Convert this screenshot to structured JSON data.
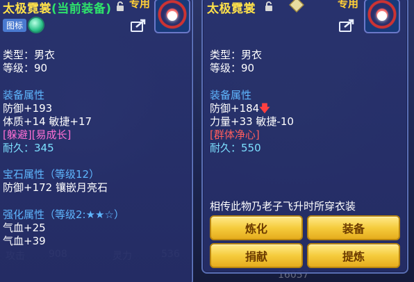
{
  "background": {
    "stat_attack_label": "攻击",
    "stat_attack_value": "908",
    "stat_spirit_label": "灵力",
    "stat_spirit_value": "536",
    "bottom_number": "16057"
  },
  "left_panel": {
    "title": "太极霓裳",
    "title_suffix": "(当前装备)",
    "exclusive_tag": "专用",
    "badge_label": "图标",
    "type_line": "类型：男衣",
    "level_line": "等级：90",
    "equip_attr_header": "装备属性",
    "defense_line": "防御+193",
    "stats_line": "体质+14 敏捷+17",
    "special_line": "[躲避][易成长]",
    "durability_line": "耐久：345",
    "gem_header": "宝石属性（等级12）",
    "gem_line": "防御+172 镶嵌月亮石",
    "enhance_header": "强化属性（等级2:★★☆）",
    "enhance_hp1": "气血+25",
    "enhance_hp2": "气血+39"
  },
  "right_panel": {
    "title": "太极霓裳",
    "exclusive_tag": "专用",
    "type_line": "类型：男衣",
    "level_line": "等级：90",
    "equip_attr_header": "装备属性",
    "defense_line": "防御+184",
    "stats_line": "力量+33 敏捷-10",
    "special_line": "[群体净心]",
    "durability_line": "耐久：550",
    "description": "相传此物乃老子飞升时所穿衣装",
    "buttons": {
      "refine": "炼化",
      "equip": "装备",
      "donate": "捐献",
      "extract": "提炼"
    }
  },
  "colors": {
    "title": "#ffe14a",
    "current_equip": "#2ee36b",
    "header": "#5fb7ff",
    "special": "#ff6fd5",
    "durability": "#7ce0ff",
    "button": "#f5cc3d"
  }
}
